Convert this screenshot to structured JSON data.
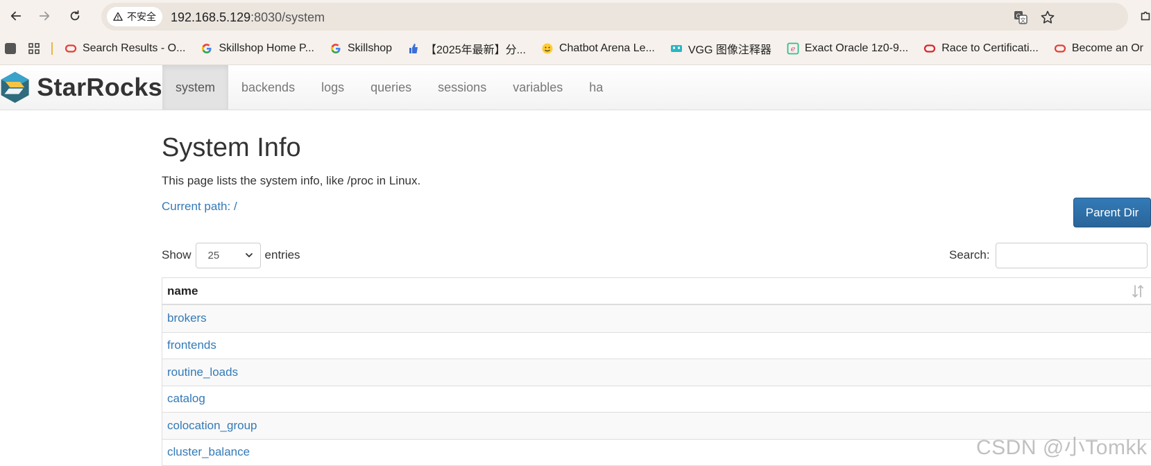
{
  "browser": {
    "security_label": "不安全",
    "url_host": "192.168.5.129",
    "url_rest": ":8030/system",
    "bookmarks": [
      {
        "label": "Search Results - O...",
        "icon": "oracle-icon",
        "color": "#e0403a"
      },
      {
        "label": "Skillshop Home P...",
        "icon": "google-icon",
        "color": "#4285f4"
      },
      {
        "label": "Skillshop",
        "icon": "google-icon",
        "color": "#4285f4"
      },
      {
        "label": "【2025年最新】分...",
        "icon": "thumbs-up-icon",
        "color": "#3a6fd8"
      },
      {
        "label": "Chatbot Arena Le...",
        "icon": "hugging-face-icon",
        "color": "#ffcc33"
      },
      {
        "label": "VGG 图像注释器",
        "icon": "vgg-icon",
        "color": "#29b6c6"
      },
      {
        "label": "Exact Oracle 1z0-9...",
        "icon": "exam-icon",
        "color": "#2fbf8f"
      },
      {
        "label": "Race to Certificati...",
        "icon": "oracle-icon",
        "color": "#d8262b"
      },
      {
        "label": "Become an Or",
        "icon": "oracle-icon",
        "color": "#e0403a"
      }
    ]
  },
  "navbar": {
    "brand": "StarRocks",
    "items": [
      "system",
      "backends",
      "logs",
      "queries",
      "sessions",
      "variables",
      "ha"
    ],
    "active_index": 0
  },
  "main": {
    "title": "System Info",
    "description": "This page lists the system info, like /proc in Linux.",
    "current_path": "Current path: /",
    "parent_dir_label": "Parent Dir",
    "show_label": "Show",
    "entries_value": "25",
    "entries_label": "entries",
    "search_label": "Search:",
    "search_value": "",
    "table": {
      "column": "name",
      "rows": [
        "brokers",
        "frontends",
        "routine_loads",
        "catalog",
        "colocation_group",
        "cluster_balance"
      ]
    }
  },
  "watermark": "CSDN @小Tomkk",
  "colors": {
    "link": "#337ab7",
    "primary_button": "#2a6599"
  }
}
